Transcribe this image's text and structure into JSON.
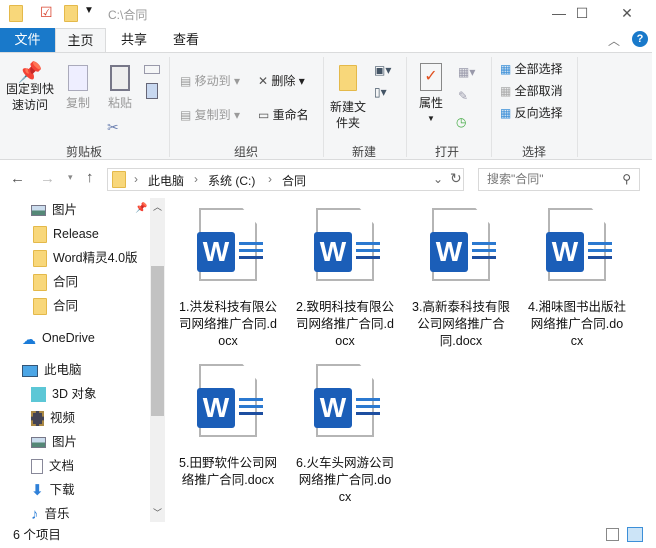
{
  "title_bar": {
    "path": "C:\\合同",
    "minimize": "—",
    "maximize": "☐",
    "close": "✕"
  },
  "tabs": {
    "file": "文件",
    "home": "主页",
    "share": "共享",
    "view": "查看"
  },
  "ribbon": {
    "pin": "固定到快速访问",
    "copy": "复制",
    "paste": "粘贴",
    "clipboard": "剪贴板",
    "move_to": "移动到",
    "copy_to": "复制到",
    "delete": "删除",
    "rename": "重命名",
    "organize": "组织",
    "new_folder": "新建文件夹",
    "new": "新建",
    "properties": "属性",
    "open": "打开",
    "select_all": "全部选择",
    "select_none": "全部取消",
    "invert": "反向选择",
    "select": "选择"
  },
  "address": {
    "crumbs": [
      "此电脑",
      "系统 (C:)",
      "合同"
    ],
    "search_placeholder": "搜索\"合同\""
  },
  "nav": {
    "quick": [
      "图片",
      "Release",
      "Word精灵4.0版",
      "合同",
      "合同"
    ],
    "onedrive": "OneDrive",
    "pc": "此电脑",
    "pc_items": [
      "3D 对象",
      "视频",
      "图片",
      "文档",
      "下载",
      "音乐"
    ]
  },
  "files": [
    "1.洪发科技有限公司网络推广合同.docx",
    "2.致明科技有限公司网络推广合同.docx",
    "3.高新泰科技有限公司网络推广合同.docx",
    "4.湘味图书出版社网络推广合同.docx",
    "5.田野软件公司网络推广合同.docx",
    "6.火车头网游公司网络推广合同.docx"
  ],
  "status": {
    "count": "6 个项目"
  },
  "colors": {
    "accent": "#1979ca",
    "word": "#1b5eb8"
  }
}
